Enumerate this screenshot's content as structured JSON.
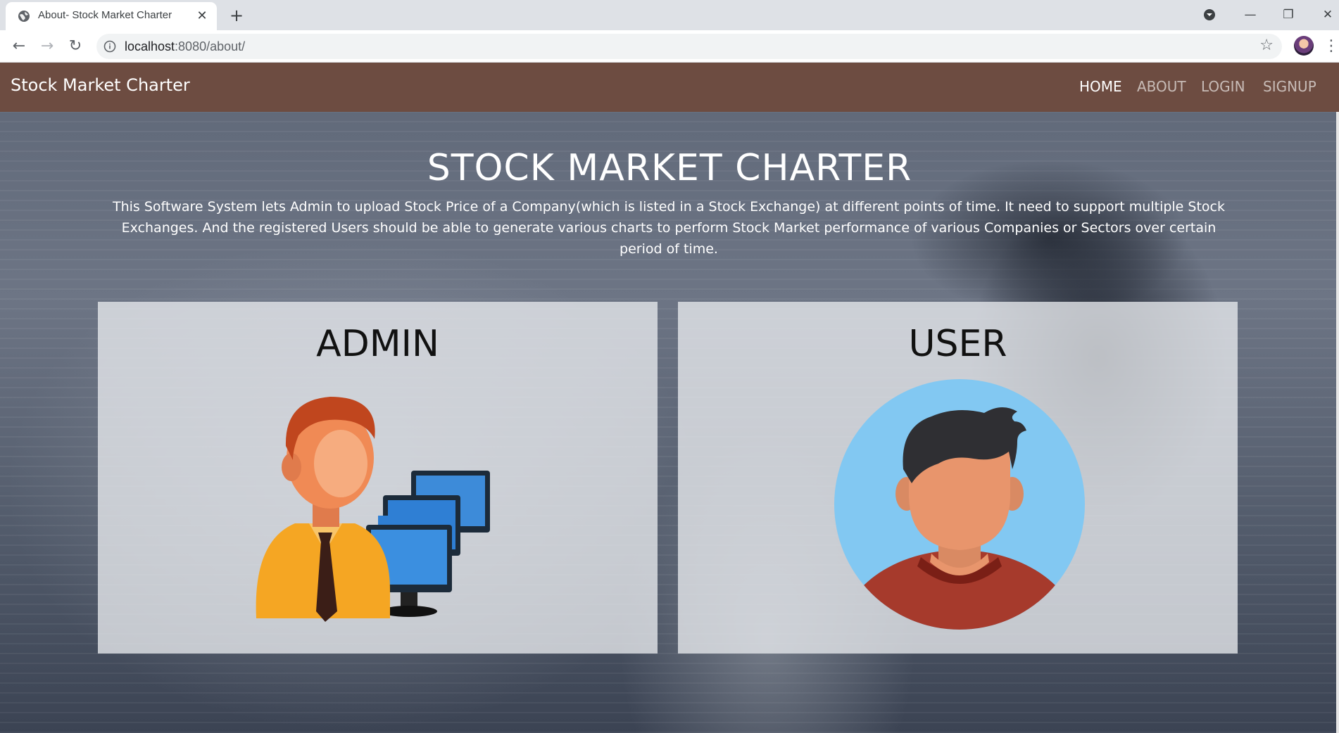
{
  "browser": {
    "tab_title": "About- Stock Market Charter",
    "url_host": "localhost",
    "url_path": ":8080/about/"
  },
  "navbar": {
    "brand": "Stock Market Charter",
    "links": [
      "HOME",
      "ABOUT",
      "LOGIN",
      "SIGNUP"
    ],
    "active_link": "HOME"
  },
  "hero": {
    "title": "STOCK MARKET CHARTER",
    "description": "This Software System lets Admin to upload Stock Price of a Company(which is listed in a Stock Exchange) at different points of time. It need to support multiple Stock Exchanges. And the registered Users should be able to generate various charts to perform Stock Market performance of various Companies or Sectors over certain period of time."
  },
  "cards": [
    {
      "title": "ADMIN",
      "illustration": "admin-with-computers-icon"
    },
    {
      "title": "USER",
      "illustration": "user-avatar-icon"
    }
  ],
  "colors": {
    "navbar": "#6d4c41",
    "card": "#e5e7eb",
    "tabstrip": "#dee1e6"
  },
  "icons": [
    "globe-icon",
    "close-icon",
    "new-tab-icon",
    "back-icon",
    "forward-icon",
    "reload-icon",
    "info-icon",
    "star-icon",
    "profile-avatar",
    "menu-icon",
    "minimize-icon",
    "maximize-icon",
    "window-close-icon",
    "tab-search-icon"
  ]
}
